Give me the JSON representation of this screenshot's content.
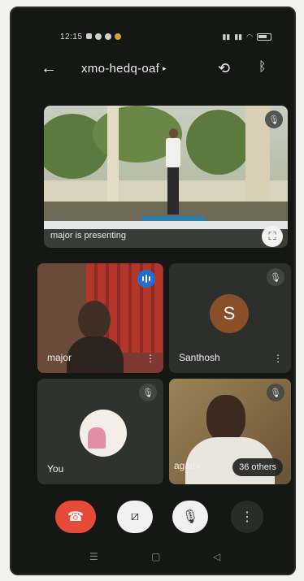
{
  "status": {
    "time": "12:15"
  },
  "header": {
    "meeting_code": "xmo-hedq-oaf",
    "caret": "▸"
  },
  "presenter": {
    "label": "major is presenting"
  },
  "participants": [
    {
      "name": "major"
    },
    {
      "name": "Santhosh",
      "initial": "S"
    },
    {
      "name": "You"
    },
    {
      "name": "agathi"
    }
  ],
  "others_chip": "36 others",
  "icons": {
    "back": "arrow-left-icon",
    "switch_camera": "switch-camera-icon",
    "bluetooth": "bluetooth-icon",
    "mic_off": "mic-off-icon",
    "fullscreen": "fullscreen-icon",
    "end_call": "end-call-icon",
    "camera_off": "camera-off-icon",
    "more": "more-vert-icon"
  },
  "colors": {
    "end_call": "#e84a3a",
    "speaking": "#1e6fcf",
    "avatar_s": "#8a4e28"
  }
}
